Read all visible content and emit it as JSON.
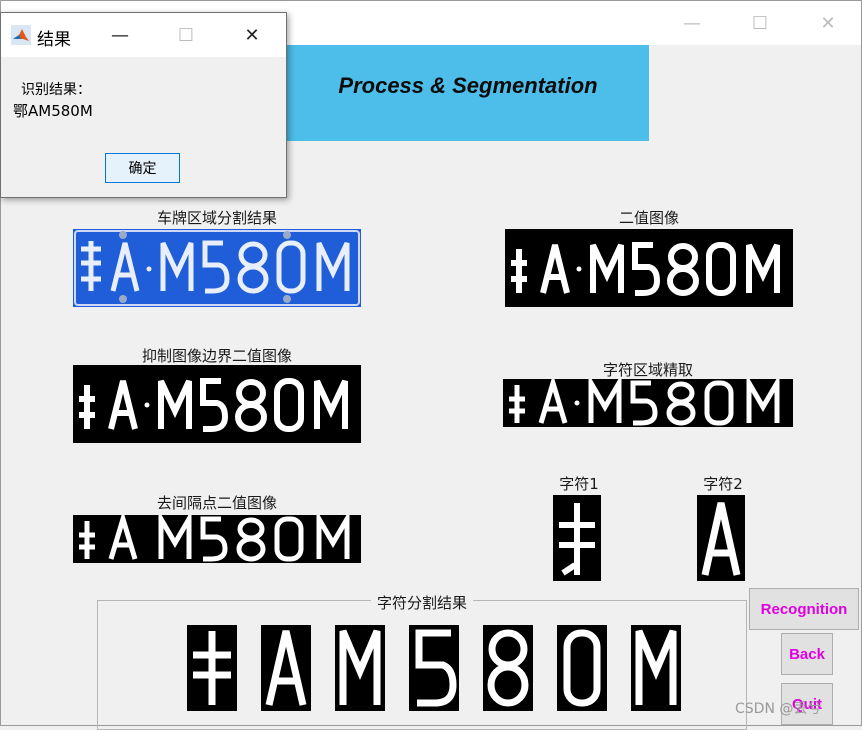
{
  "main_window": {
    "header_title": "Process & Segmentation",
    "controls": {
      "minimize": "—",
      "maximize": "☐",
      "close": "✕"
    }
  },
  "images": {
    "plate_region": "车牌区域分割结果",
    "binary": "二值图像",
    "suppressed_border": "抑制图像边界二值图像",
    "char_region": "字符区域精取",
    "removed_dots": "去间隔点二值图像",
    "char1": "字符1",
    "char2": "字符2",
    "segmentation_result": "字符分割结果"
  },
  "plate": {
    "text": "鄂A·M580M",
    "chars": [
      "鄂",
      "A",
      "M",
      "5",
      "8",
      "0",
      "M"
    ]
  },
  "buttons": {
    "recognition": "Recognition",
    "back": "Back",
    "quit": "Quit"
  },
  "watermark": "CSDN @丢兮",
  "dialog": {
    "title": "结果",
    "prompt": "识别结果：",
    "result": "鄂AM580M",
    "ok": "确定",
    "controls": {
      "minimize": "—",
      "maximize": "☐",
      "close": "✕"
    }
  },
  "colors": {
    "header_bg": "#4dbde9",
    "plate_blue": "#1f5ed8",
    "button_text": "#e000e0"
  }
}
